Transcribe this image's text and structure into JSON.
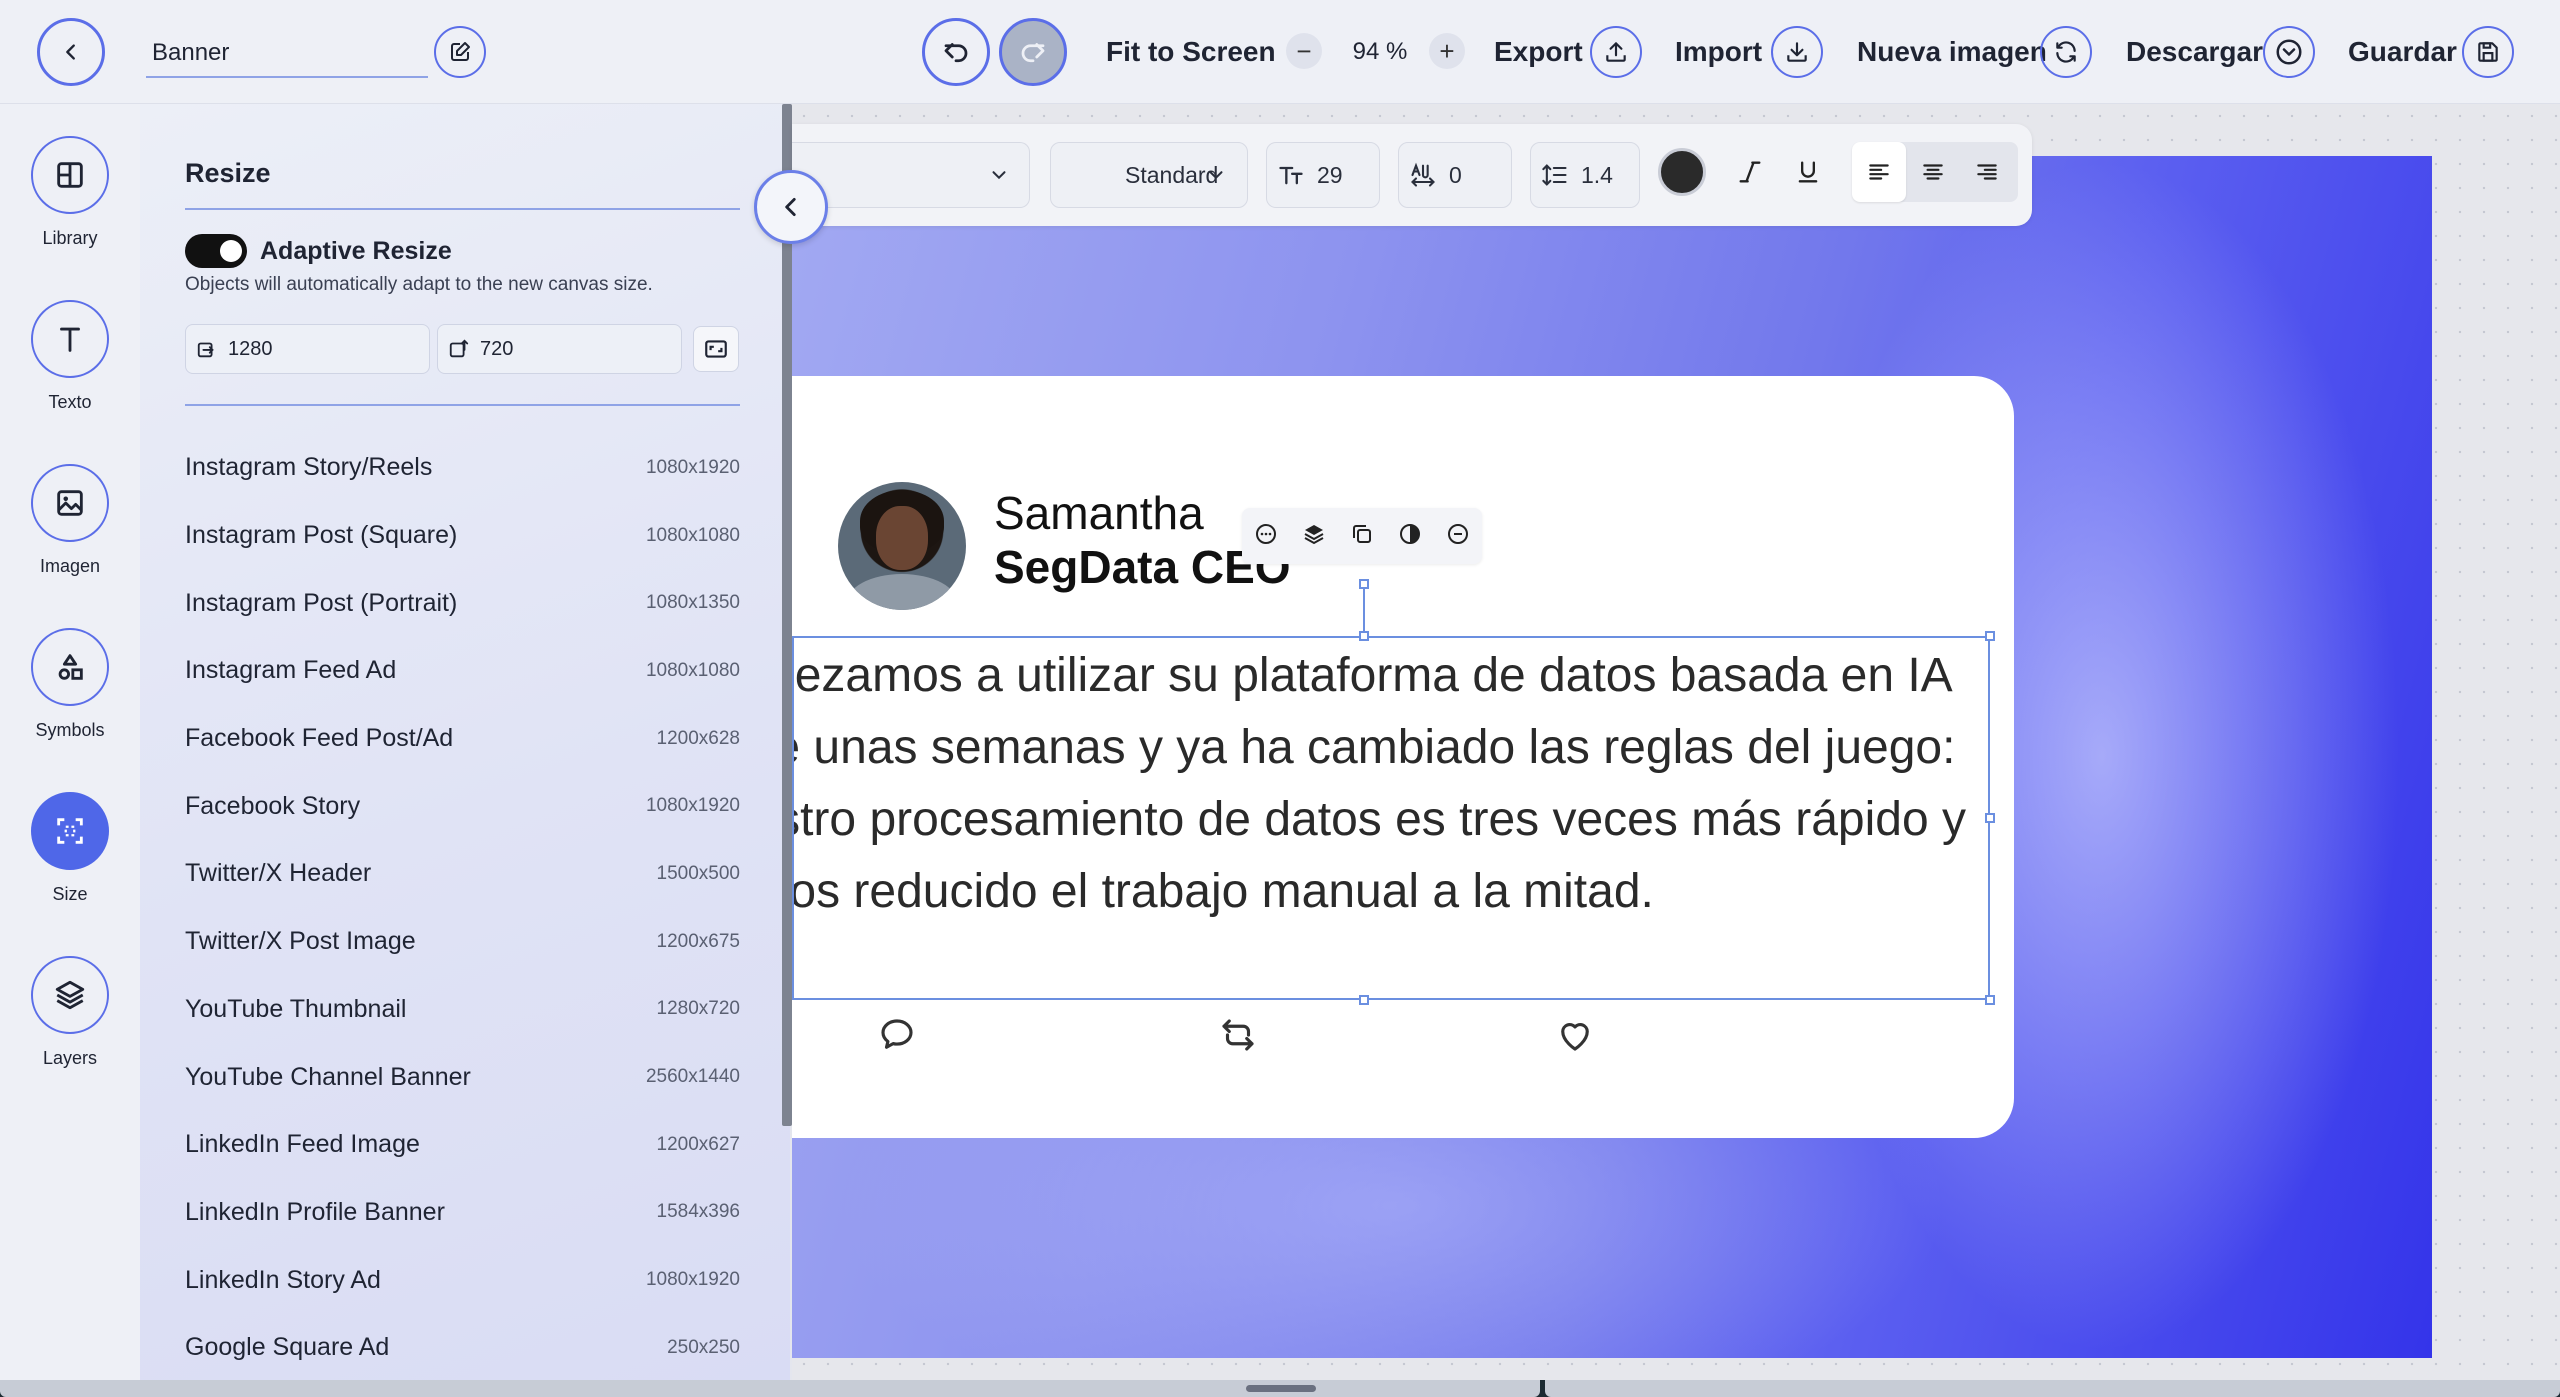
{
  "header": {
    "title_value": "Banner",
    "fit_label": "Fit to Screen",
    "zoom_value": "94 %",
    "zoom_minus": "−",
    "zoom_plus": "+",
    "export_label": "Export",
    "import_label": "Import",
    "new_image_label": "Nueva imagen",
    "download_label": "Descargar",
    "save_label": "Guardar"
  },
  "rail": {
    "items": [
      {
        "label": "Library",
        "icon": "layout-icon"
      },
      {
        "label": "Texto",
        "icon": "text-icon"
      },
      {
        "label": "Imagen",
        "icon": "image-icon"
      },
      {
        "label": "Symbols",
        "icon": "shapes-icon"
      },
      {
        "label": "Size",
        "icon": "resize-icon",
        "active": true
      },
      {
        "label": "Layers",
        "icon": "layers-icon"
      }
    ]
  },
  "panel": {
    "title": "Resize",
    "adaptive_label": "Adaptive Resize",
    "adaptive_on": true,
    "adaptive_desc": "Objects will automatically adapt to the new canvas size.",
    "width": "1280",
    "height": "720",
    "presets": [
      {
        "name": "Instagram Story/Reels",
        "size": "1080x1920"
      },
      {
        "name": "Instagram Post (Square)",
        "size": "1080x1080"
      },
      {
        "name": "Instagram Post (Portrait)",
        "size": "1080x1350"
      },
      {
        "name": "Instagram Feed Ad",
        "size": "1080x1080"
      },
      {
        "name": "Facebook Feed Post/Ad",
        "size": "1200x628"
      },
      {
        "name": "Facebook Story",
        "size": "1080x1920"
      },
      {
        "name": "Twitter/X Header",
        "size": "1500x500"
      },
      {
        "name": "Twitter/X Post Image",
        "size": "1200x675"
      },
      {
        "name": "YouTube Thumbnail",
        "size": "1280x720"
      },
      {
        "name": "YouTube Channel Banner",
        "size": "2560x1440"
      },
      {
        "name": "LinkedIn Feed Image",
        "size": "1200x627"
      },
      {
        "name": "LinkedIn Profile Banner",
        "size": "1584x396"
      },
      {
        "name": "LinkedIn Story Ad",
        "size": "1080x1920"
      },
      {
        "name": "Google Square Ad",
        "size": "250x250"
      }
    ]
  },
  "format_bar": {
    "style_value": "Standard",
    "font_size": "29",
    "letter_spacing": "0",
    "line_height": "1.4",
    "text_color": "#2a2a2a"
  },
  "card": {
    "name": "Samantha",
    "role": "SegData CEO",
    "quote": "Empezamos a utilizar su plataforma de datos basada en IA hace unas semanas y ya ha cambiado las reglas del juego: nuestro procesamiento de datos es tres veces más rápido y hemos reducido el trabajo manual a la mitad."
  },
  "colors": {
    "accent": "#4f67e8",
    "artboard_start": "#a2a9f2",
    "artboard_end": "#3434ea"
  }
}
